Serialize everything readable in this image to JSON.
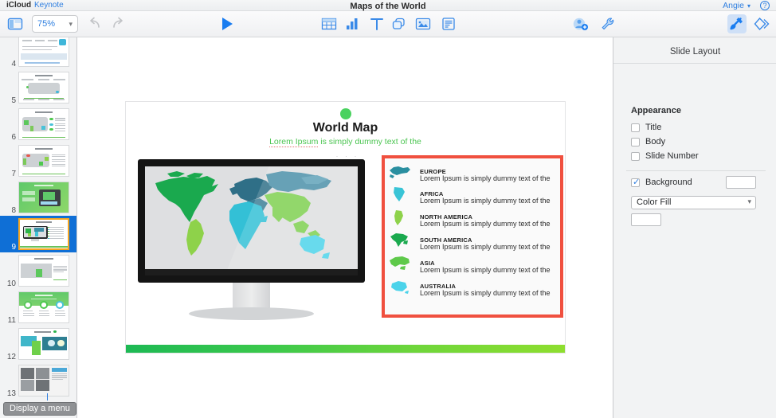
{
  "app": {
    "brand": "iCloud",
    "app_name": "Keynote",
    "document_title": "Maps of the World",
    "user": "Angie",
    "user_chevron": "▾",
    "help_label": "?"
  },
  "toolbar": {
    "view_icon": "view-navigator-icon",
    "zoom_value": "75%",
    "zoom_chevron": "▾",
    "undo_icon": "undo-icon",
    "redo_icon": "redo-icon",
    "play_icon": "play-icon",
    "insert_table_icon": "table-icon",
    "insert_chart_icon": "chart-icon",
    "insert_text_icon": "text-icon",
    "insert_shape_icon": "shape-icon",
    "insert_media_icon": "media-icon",
    "insert_comment_icon": "comment-icon",
    "collaborate_icon": "add-person-icon",
    "tools_icon": "wrench-icon",
    "format_icon": "paintbrush-icon",
    "animate_icon": "animate-icon"
  },
  "navigator": {
    "slides": [
      {
        "number": "4",
        "kind": "chart-row"
      },
      {
        "number": "5",
        "kind": "world-map-wide"
      },
      {
        "number": "6",
        "kind": "world-map-bullets"
      },
      {
        "number": "7",
        "kind": "usa-map"
      },
      {
        "number": "8",
        "kind": "green-tablet"
      },
      {
        "number": "9",
        "kind": "monitor-map",
        "selected": true
      },
      {
        "number": "10",
        "kind": "grey-map-text"
      },
      {
        "number": "11",
        "kind": "green-circles"
      },
      {
        "number": "12",
        "kind": "samerica-teal"
      },
      {
        "number": "13",
        "kind": "photo-collage"
      }
    ]
  },
  "slide": {
    "title": "World Map",
    "subtitle_prefix": "Lorem Ipsum",
    "subtitle_rest": " is simply dummy text of the",
    "dots": "· · ·",
    "continents": [
      {
        "name": "EUROPE",
        "body": "Lorem Ipsum is simply dummy text of the",
        "color": "#2a8fa0"
      },
      {
        "name": "AFRICA",
        "body": "Lorem Ipsum is simply dummy text of the",
        "color": "#39c4d6"
      },
      {
        "name": "NORTH AMERICA",
        "body": "Lorem Ipsum is simply dummy text of the",
        "color": "#8ed24a"
      },
      {
        "name": "SOUTH AMERICA",
        "body": "Lorem Ipsum is simply dummy text of the",
        "color": "#1aa94e"
      },
      {
        "name": "ASIA",
        "body": "Lorem Ipsum is simply dummy text of the",
        "color": "#5ec94a"
      },
      {
        "name": "AUSTRALIA",
        "body": "Lorem Ipsum is simply dummy text of the",
        "color": "#4cd3ea"
      }
    ],
    "selection_border_color": "#f0503f"
  },
  "inspector": {
    "title": "Slide Layout",
    "appearance_label": "Appearance",
    "checkboxes": [
      {
        "label": "Title",
        "checked": false
      },
      {
        "label": "Body",
        "checked": false
      },
      {
        "label": "Slide Number",
        "checked": false
      }
    ],
    "background_label": "Background",
    "background_checked": true,
    "fill_type": "Color Fill",
    "fill_chevron": "▾"
  },
  "tooltip": {
    "text": "Display a menu"
  },
  "colors": {
    "accent_blue": "#2f7fe0",
    "selection_blue": "#0f6fd6",
    "thumb_highlight": "#f5a623",
    "slide_green": "#4cc552",
    "red_outline": "#f0503f"
  }
}
